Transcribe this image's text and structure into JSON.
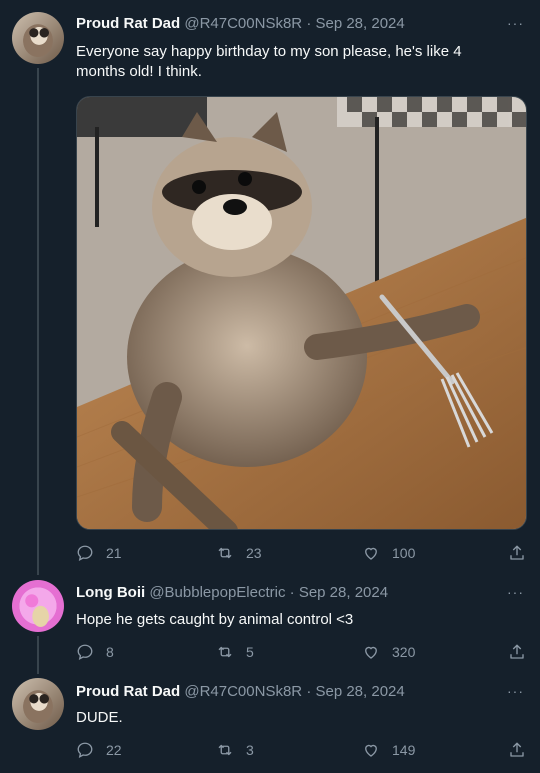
{
  "tweets": [
    {
      "name": "Proud Rat Dad",
      "handle": "@R47C00NSk8R",
      "date": "Sep 28, 2024",
      "text": "Everyone say happy birthday to my son please, he's like 4 months old! I think.",
      "replies": "21",
      "retweets": "23",
      "likes": "100",
      "avatar_icon": "raccoon-avatar"
    },
    {
      "name": "Long Boii",
      "handle": "@BubblepopElectric",
      "date": "Sep 28, 2024",
      "text": "Hope he gets caught by animal control <3",
      "replies": "8",
      "retweets": "5",
      "likes": "320",
      "avatar_icon": "pink-cartoon-avatar"
    },
    {
      "name": "Proud Rat Dad",
      "handle": "@R47C00NSk8R",
      "date": "Sep 28, 2024",
      "text": "DUDE.",
      "replies": "22",
      "retweets": "3",
      "likes": "149",
      "avatar_icon": "raccoon-avatar"
    }
  ],
  "separator": "·",
  "more_label": "···",
  "colors": {
    "background": "#15202b",
    "text": "#f7f9f9",
    "muted": "#8b98a5",
    "thread_line": "#38444d"
  }
}
